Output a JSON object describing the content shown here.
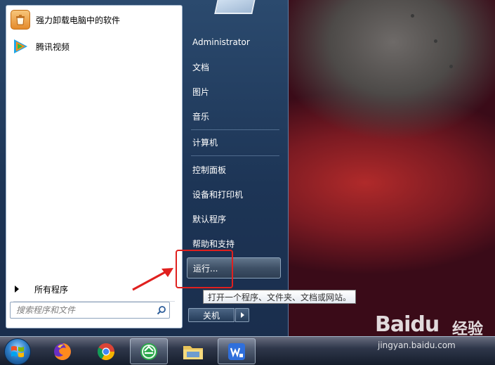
{
  "start_menu": {
    "programs": [
      {
        "label": "强力卸载电脑中的软件",
        "icon": "uninstall-icon"
      },
      {
        "label": "腾讯视频",
        "icon": "tencent-video-icon"
      }
    ],
    "all_programs_label": "所有程序",
    "search_placeholder": "搜索程序和文件",
    "right_items": [
      {
        "label": "Administrator"
      },
      {
        "label": "文档"
      },
      {
        "label": "图片"
      },
      {
        "label": "音乐"
      },
      {
        "label": "计算机"
      },
      {
        "label": "控制面板"
      },
      {
        "label": "设备和打印机"
      },
      {
        "label": "默认程序"
      },
      {
        "label": "帮助和支持"
      },
      {
        "label": "运行..."
      }
    ],
    "shutdown_label": "关机",
    "tooltip": "打开一个程序、文件夹、文档或网站。"
  },
  "taskbar": {
    "apps": [
      "firefox-icon",
      "chrome-icon",
      "browser-icon",
      "file-explorer-icon",
      "wps-icon"
    ]
  },
  "watermark": {
    "logo": "Baidu",
    "text": "经验",
    "url": "jingyan.baidu.com"
  },
  "colors": {
    "annotation_red": "#e0201e",
    "menu_blue": "#1d3556"
  }
}
